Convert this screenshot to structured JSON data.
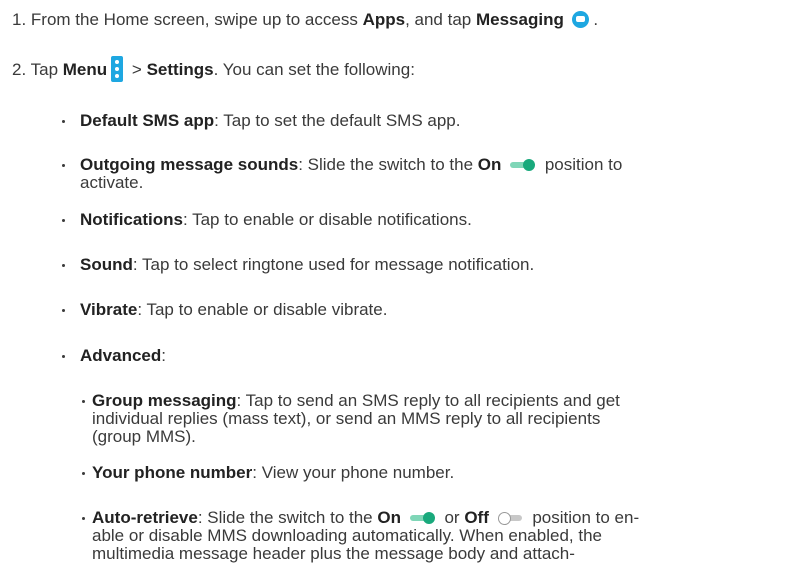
{
  "step1": {
    "num": "1.",
    "text_a": "From the Home screen, swipe up to access",
    "apps": "Apps",
    "text_b": ", and tap",
    "messaging": "Messaging",
    "end": "."
  },
  "step2": {
    "num": "2.",
    "tap": "Tap",
    "menu": "Menu",
    "gt": ">",
    "settings": "Settings",
    "rest": ". You can set the following:"
  },
  "items": {
    "default_sms": {
      "label": "Default SMS app",
      "text": ": Tap to set the default SMS app."
    },
    "outgoing": {
      "label": "Outgoing message sounds",
      "text_a": ": Slide the switch to the",
      "on": "On",
      "text_b": "position to",
      "line2": "activate."
    },
    "notifications": {
      "label": "Notifications",
      "text": ": Tap to enable or disable notifications."
    },
    "sound": {
      "label": "Sound",
      "text": ": Tap to select ringtone used for message notification."
    },
    "vibrate": {
      "label": "Vibrate",
      "text": ": Tap to enable or disable vibrate."
    },
    "advanced": {
      "label": "Advanced",
      "text": ":"
    }
  },
  "sub": {
    "group": {
      "label": "Group messaging",
      "text": ": Tap to send an SMS reply to all recipients and get",
      "line2": "individual replies (mass text), or send an MMS reply to all recipients",
      "line3": "(group MMS)."
    },
    "phone": {
      "label": "Your phone number",
      "text": ": View your phone number."
    },
    "auto": {
      "label": "Auto-retrieve",
      "text_a": ": Slide the switch to the",
      "on": "On",
      "or": "or",
      "off": "Off",
      "text_b": "position to en-",
      "line2": "able or disable MMS downloading automatically. When enabled, the",
      "line3": "multimedia message header plus the message body and attach-"
    }
  },
  "colors": {
    "icon_blue": "#1ea7e1",
    "toggle_green": "#19a97c"
  },
  "icons": [
    "messaging-icon",
    "menu-icon",
    "toggle-on-icon",
    "toggle-off-icon"
  ]
}
